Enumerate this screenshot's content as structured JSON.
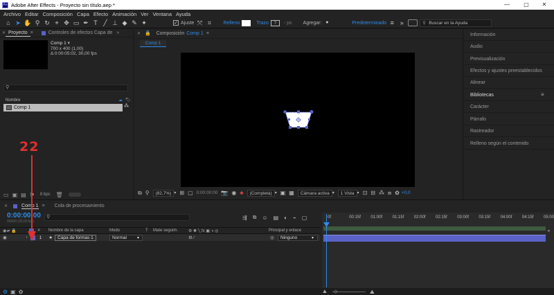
{
  "window": {
    "title": "Adobe After Effects - Proyecto sin título.aep *",
    "logo_text": "Ae",
    "minimize": "—",
    "maximize": "▢",
    "close": "✕"
  },
  "menu": [
    "Archivo",
    "Editar",
    "Composición",
    "Capa",
    "Efecto",
    "Animación",
    "Ver",
    "Ventana",
    "Ayuda"
  ],
  "toolbar": {
    "ajuste": "Ajuste",
    "relleno": "Relleno",
    "trazo": "Trazo",
    "trazo_value": "?",
    "px": "- px",
    "agregar": "Agregar:",
    "workspace": "Predeterminado",
    "search_placeholder": "Buscar en la Ayuda"
  },
  "project": {
    "tab_label": "Proyecto",
    "tab2_label": "Controles de efectos Capa de",
    "comp_name": "Comp 1",
    "comp_dims": "700 x 400 (1,00)",
    "comp_duration": "Δ 0:00:05:02, 30,00 fps",
    "col_name": "Nombre",
    "item_name": "Comp 1",
    "bpc": "8 bpc"
  },
  "composition": {
    "tab_label": "Composición",
    "tab_comp": "Comp 1",
    "subtab": "Comp 1",
    "zoom": "(82,7%)",
    "timecode": "0:00:00:00",
    "resolution": "(Completa)",
    "camera": "Cámara activa",
    "views": "1 Vista",
    "exposure": "+0,0"
  },
  "right_panel": {
    "items": [
      "Información",
      "Audio",
      "Previsualización",
      "Efectos y ajustes preestablecidos",
      "Alinear",
      "Bibliotecas",
      "Carácter",
      "Párrafo",
      "Rastreador",
      "Relleno según el contenido"
    ]
  },
  "timeline": {
    "tab_comp": "Comp 1",
    "tab_queue": "Cola de procesamiento",
    "time": "0:00:00:00",
    "time_sub": "00000 (30,00 fps)",
    "col_hash": "#",
    "col_layer_name": "Nombre de la capa",
    "col_mode": "Modo",
    "col_t": "T",
    "col_matte": "Mate seguim.",
    "col_parent": "Principal y enlace",
    "layer_num": "1",
    "layer_name": "Capa de formas 1",
    "layer_mode": "Normal",
    "layer_parent": "Ninguno",
    "ruler": [
      "0f",
      "00:15f",
      "01:00f",
      "01:15f",
      "02:00f",
      "02:15f",
      "03:00f",
      "03:15f",
      "04:00f",
      "04:15f",
      "05:00f"
    ]
  },
  "annotation": {
    "number": "22"
  },
  "colors": {
    "accent": "#2d8ceb",
    "annotation": "#e03030",
    "layer_bar": "#5a62c8",
    "label_swatch": "#5a62c8"
  }
}
